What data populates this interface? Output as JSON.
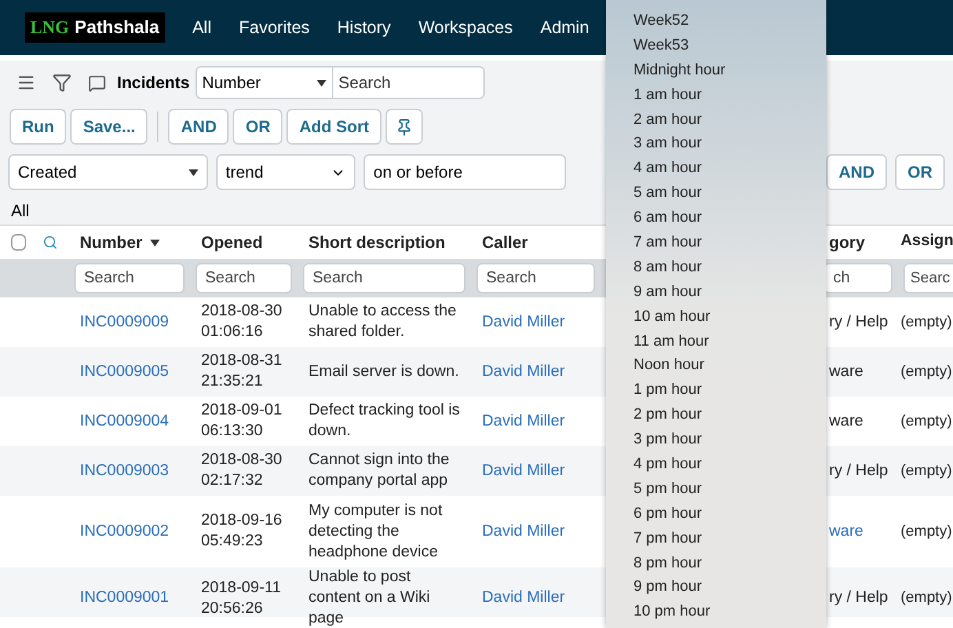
{
  "header": {
    "logo_initials": "LNG",
    "logo_text": "Pathshala",
    "nav": [
      "All",
      "Favorites",
      "History",
      "Workspaces",
      "Admin"
    ]
  },
  "list_bar": {
    "title": "Incidents",
    "field_select": "Number",
    "search_placeholder": "Search"
  },
  "actions": {
    "left": [
      "Run",
      "Save..."
    ],
    "right": [
      "AND",
      "OR",
      "Add Sort"
    ]
  },
  "condition": {
    "field": "Created",
    "operator": "trend",
    "value": "on or before",
    "buttons": [
      "AND",
      "OR"
    ]
  },
  "breadcrumb": "All",
  "table": {
    "columns": [
      {
        "label": "Number",
        "sorted": true
      },
      {
        "label": "Opened",
        "sorted": false
      },
      {
        "label": "Short description",
        "sorted": false
      },
      {
        "label": "Caller",
        "sorted": false
      },
      {
        "label": "gory",
        "sorted": false
      },
      {
        "label": "Assign",
        "sorted": false
      }
    ],
    "select_all_checked": false,
    "search_placeholders": [
      "Search",
      "Search",
      "Search",
      "Search",
      "ch",
      "Searc"
    ],
    "rows": [
      {
        "number": "INC0009009",
        "opened": "2018-08-30 01:06:16",
        "description": "Unable to access the shared folder.",
        "caller": "David Miller",
        "category": "ry / Help",
        "category_link": false,
        "assigned": "(empty)"
      },
      {
        "number": "INC0009005",
        "opened": "2018-08-31 21:35:21",
        "description": "Email server is down.",
        "caller": "David Miller",
        "category": "ware",
        "category_link": false,
        "assigned": "(empty)"
      },
      {
        "number": "INC0009004",
        "opened": "2018-09-01 06:13:30",
        "description": "Defect tracking tool is down.",
        "caller": "David Miller",
        "category": "ware",
        "category_link": false,
        "assigned": "(empty)"
      },
      {
        "number": "INC0009003",
        "opened": "2018-08-30 02:17:32",
        "description": "Cannot sign into the company portal app",
        "caller": "David Miller",
        "category": "ry / Help",
        "category_link": false,
        "assigned": "(empty)"
      },
      {
        "number": "INC0009002",
        "opened": "2018-09-16 05:49:23",
        "description": "My computer is not detecting the headphone device",
        "caller": "David Miller",
        "category": "ware",
        "category_link": true,
        "assigned": "(empty)"
      },
      {
        "number": "INC0009001",
        "opened": "2018-09-11 20:56:26",
        "description": "Unable to post content on a Wiki page",
        "caller": "David Miller",
        "category": "ry / Help",
        "category_link": false,
        "assigned": "(empty)"
      }
    ]
  },
  "dropdown": {
    "options": [
      "Week52",
      "Week53",
      "Midnight hour",
      "1 am hour",
      "2 am hour",
      "3 am hour",
      "4 am hour",
      "5 am hour",
      "6 am hour",
      "7 am hour",
      "8 am hour",
      "9 am hour",
      "10 am hour",
      "11 am hour",
      "Noon hour",
      "1 pm hour",
      "2 pm hour",
      "3 pm hour",
      "4 pm hour",
      "5 pm hour",
      "6 pm hour",
      "7 pm hour",
      "8 pm hour",
      "9 pm hour",
      "10 pm hour"
    ]
  }
}
